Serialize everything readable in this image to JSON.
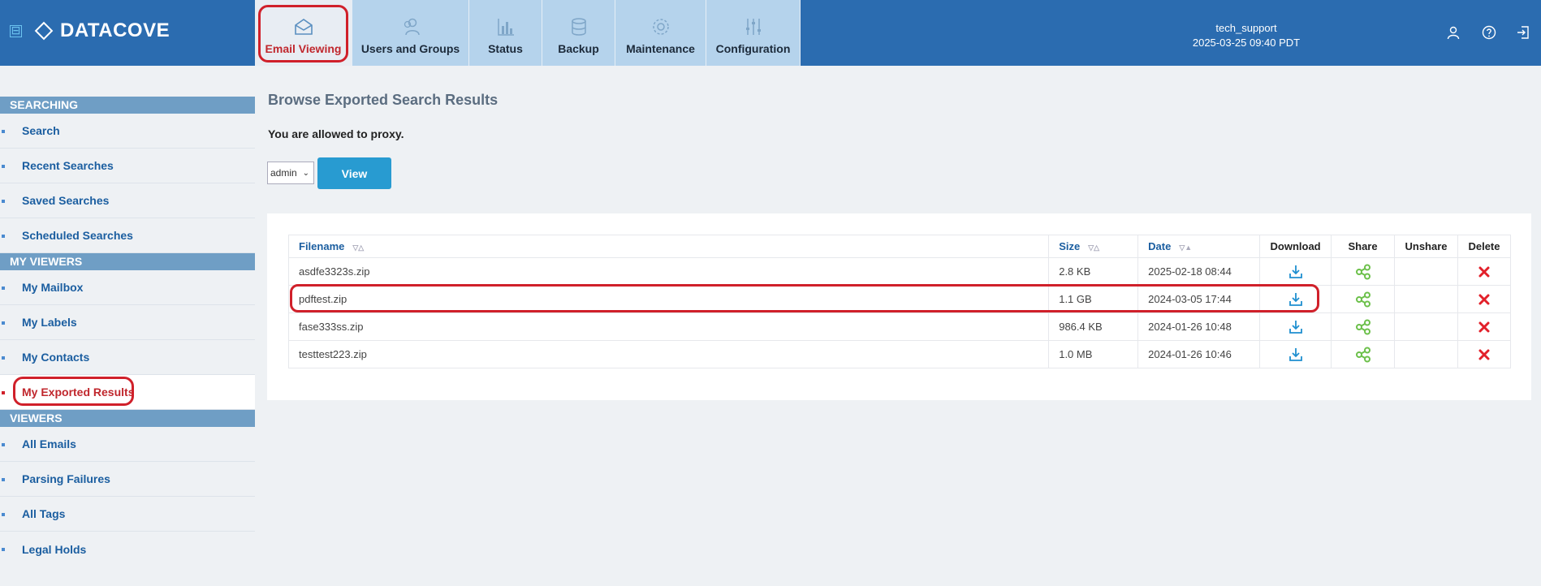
{
  "app": {
    "brand": "DATACOVE",
    "collapse_glyph": "⊟"
  },
  "tabs": [
    {
      "label": "Email Viewing",
      "icon": "envelope-icon",
      "active": true
    },
    {
      "label": "Users and Groups",
      "icon": "users-icon",
      "active": false
    },
    {
      "label": "Status",
      "icon": "bar-chart-icon",
      "active": false
    },
    {
      "label": "Backup",
      "icon": "database-icon",
      "active": false
    },
    {
      "label": "Maintenance",
      "icon": "gear-icon",
      "active": false
    },
    {
      "label": "Configuration",
      "icon": "sliders-icon",
      "active": false
    }
  ],
  "user": {
    "name": "tech_support",
    "datetime": "2025-03-25 09:40 PDT"
  },
  "header_icons": [
    "user-icon",
    "help-icon",
    "logout-icon"
  ],
  "sidebar": {
    "sections": [
      {
        "title": "SEARCHING",
        "items": [
          {
            "label": "Search"
          },
          {
            "label": "Recent Searches"
          },
          {
            "label": "Saved Searches"
          },
          {
            "label": "Scheduled Searches"
          }
        ]
      },
      {
        "title": "MY VIEWERS",
        "items": [
          {
            "label": "My Mailbox"
          },
          {
            "label": "My Labels"
          },
          {
            "label": "My Contacts"
          },
          {
            "label": "My Exported Results",
            "active": true
          }
        ]
      },
      {
        "title": "VIEWERS",
        "items": [
          {
            "label": "All Emails"
          },
          {
            "label": "Parsing Failures"
          },
          {
            "label": "All Tags"
          },
          {
            "label": "Legal Holds"
          }
        ]
      }
    ]
  },
  "main": {
    "title": "Browse Exported Search Results",
    "proxy_note": "You are allowed to proxy.",
    "user_select": {
      "value": "admin"
    },
    "view_label": "View"
  },
  "table": {
    "headers": {
      "filename": "Filename",
      "size": "Size",
      "date": "Date",
      "download": "Download",
      "share": "Share",
      "unshare": "Unshare",
      "delete": "Delete"
    },
    "sort_glyphs": {
      "filename": "▽△",
      "size": "▽△",
      "date": "▽▲"
    },
    "rows": [
      {
        "filename": "asdfe3323s.zip",
        "size": "2.8 KB",
        "date": "2025-02-18 08:44"
      },
      {
        "filename": "pdftest.zip",
        "size": "1.1 GB",
        "date": "2024-03-05 17:44"
      },
      {
        "filename": "fase333ss.zip",
        "size": "986.4 KB",
        "date": "2024-01-26 10:48"
      },
      {
        "filename": "testtest223.zip",
        "size": "1.0 MB",
        "date": "2024-01-26 10:46"
      }
    ]
  },
  "colors": {
    "header": "#2b6cb0",
    "tab": "#b5d3ec",
    "accent_red": "#d0202a",
    "link_blue": "#1b5ea0",
    "view_button": "#289bd1",
    "share_green": "#6cc04a"
  }
}
